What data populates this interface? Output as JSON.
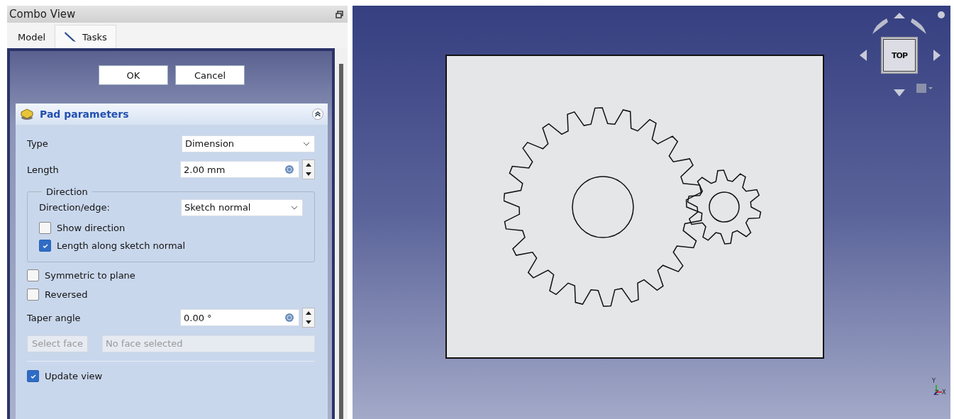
{
  "window": {
    "title": "Combo View"
  },
  "tabs": [
    {
      "label": "Model",
      "selected": false
    },
    {
      "label": "Tasks",
      "selected": true
    }
  ],
  "buttons": [
    "OK",
    "Cancel"
  ],
  "panel": {
    "title": "Pad parameters",
    "expanded": true,
    "rows": [
      {
        "kind": "select",
        "label": "Type",
        "value": "Dimension"
      },
      {
        "kind": "spin",
        "label": "Length",
        "value": "2.00 mm"
      }
    ],
    "direction": {
      "title": "Direction",
      "label": "Direction/edge:",
      "value": "Sketch normal",
      "checks": [
        {
          "label": "Show direction",
          "checked": false
        },
        {
          "label": "Length along sketch normal",
          "checked": true
        }
      ]
    },
    "checks": [
      {
        "label": "Symmetric to plane",
        "checked": false
      },
      {
        "label": "Reversed",
        "checked": false
      }
    ],
    "taper": {
      "label": "Taper angle",
      "value": "0.00 °"
    },
    "face": {
      "button": "Select face",
      "placeholder": "No face selected"
    },
    "update": {
      "label": "Update view",
      "checked": true
    }
  },
  "view": {
    "cube_face": "TOP",
    "axes": [
      "Y",
      "Z",
      "X"
    ]
  }
}
